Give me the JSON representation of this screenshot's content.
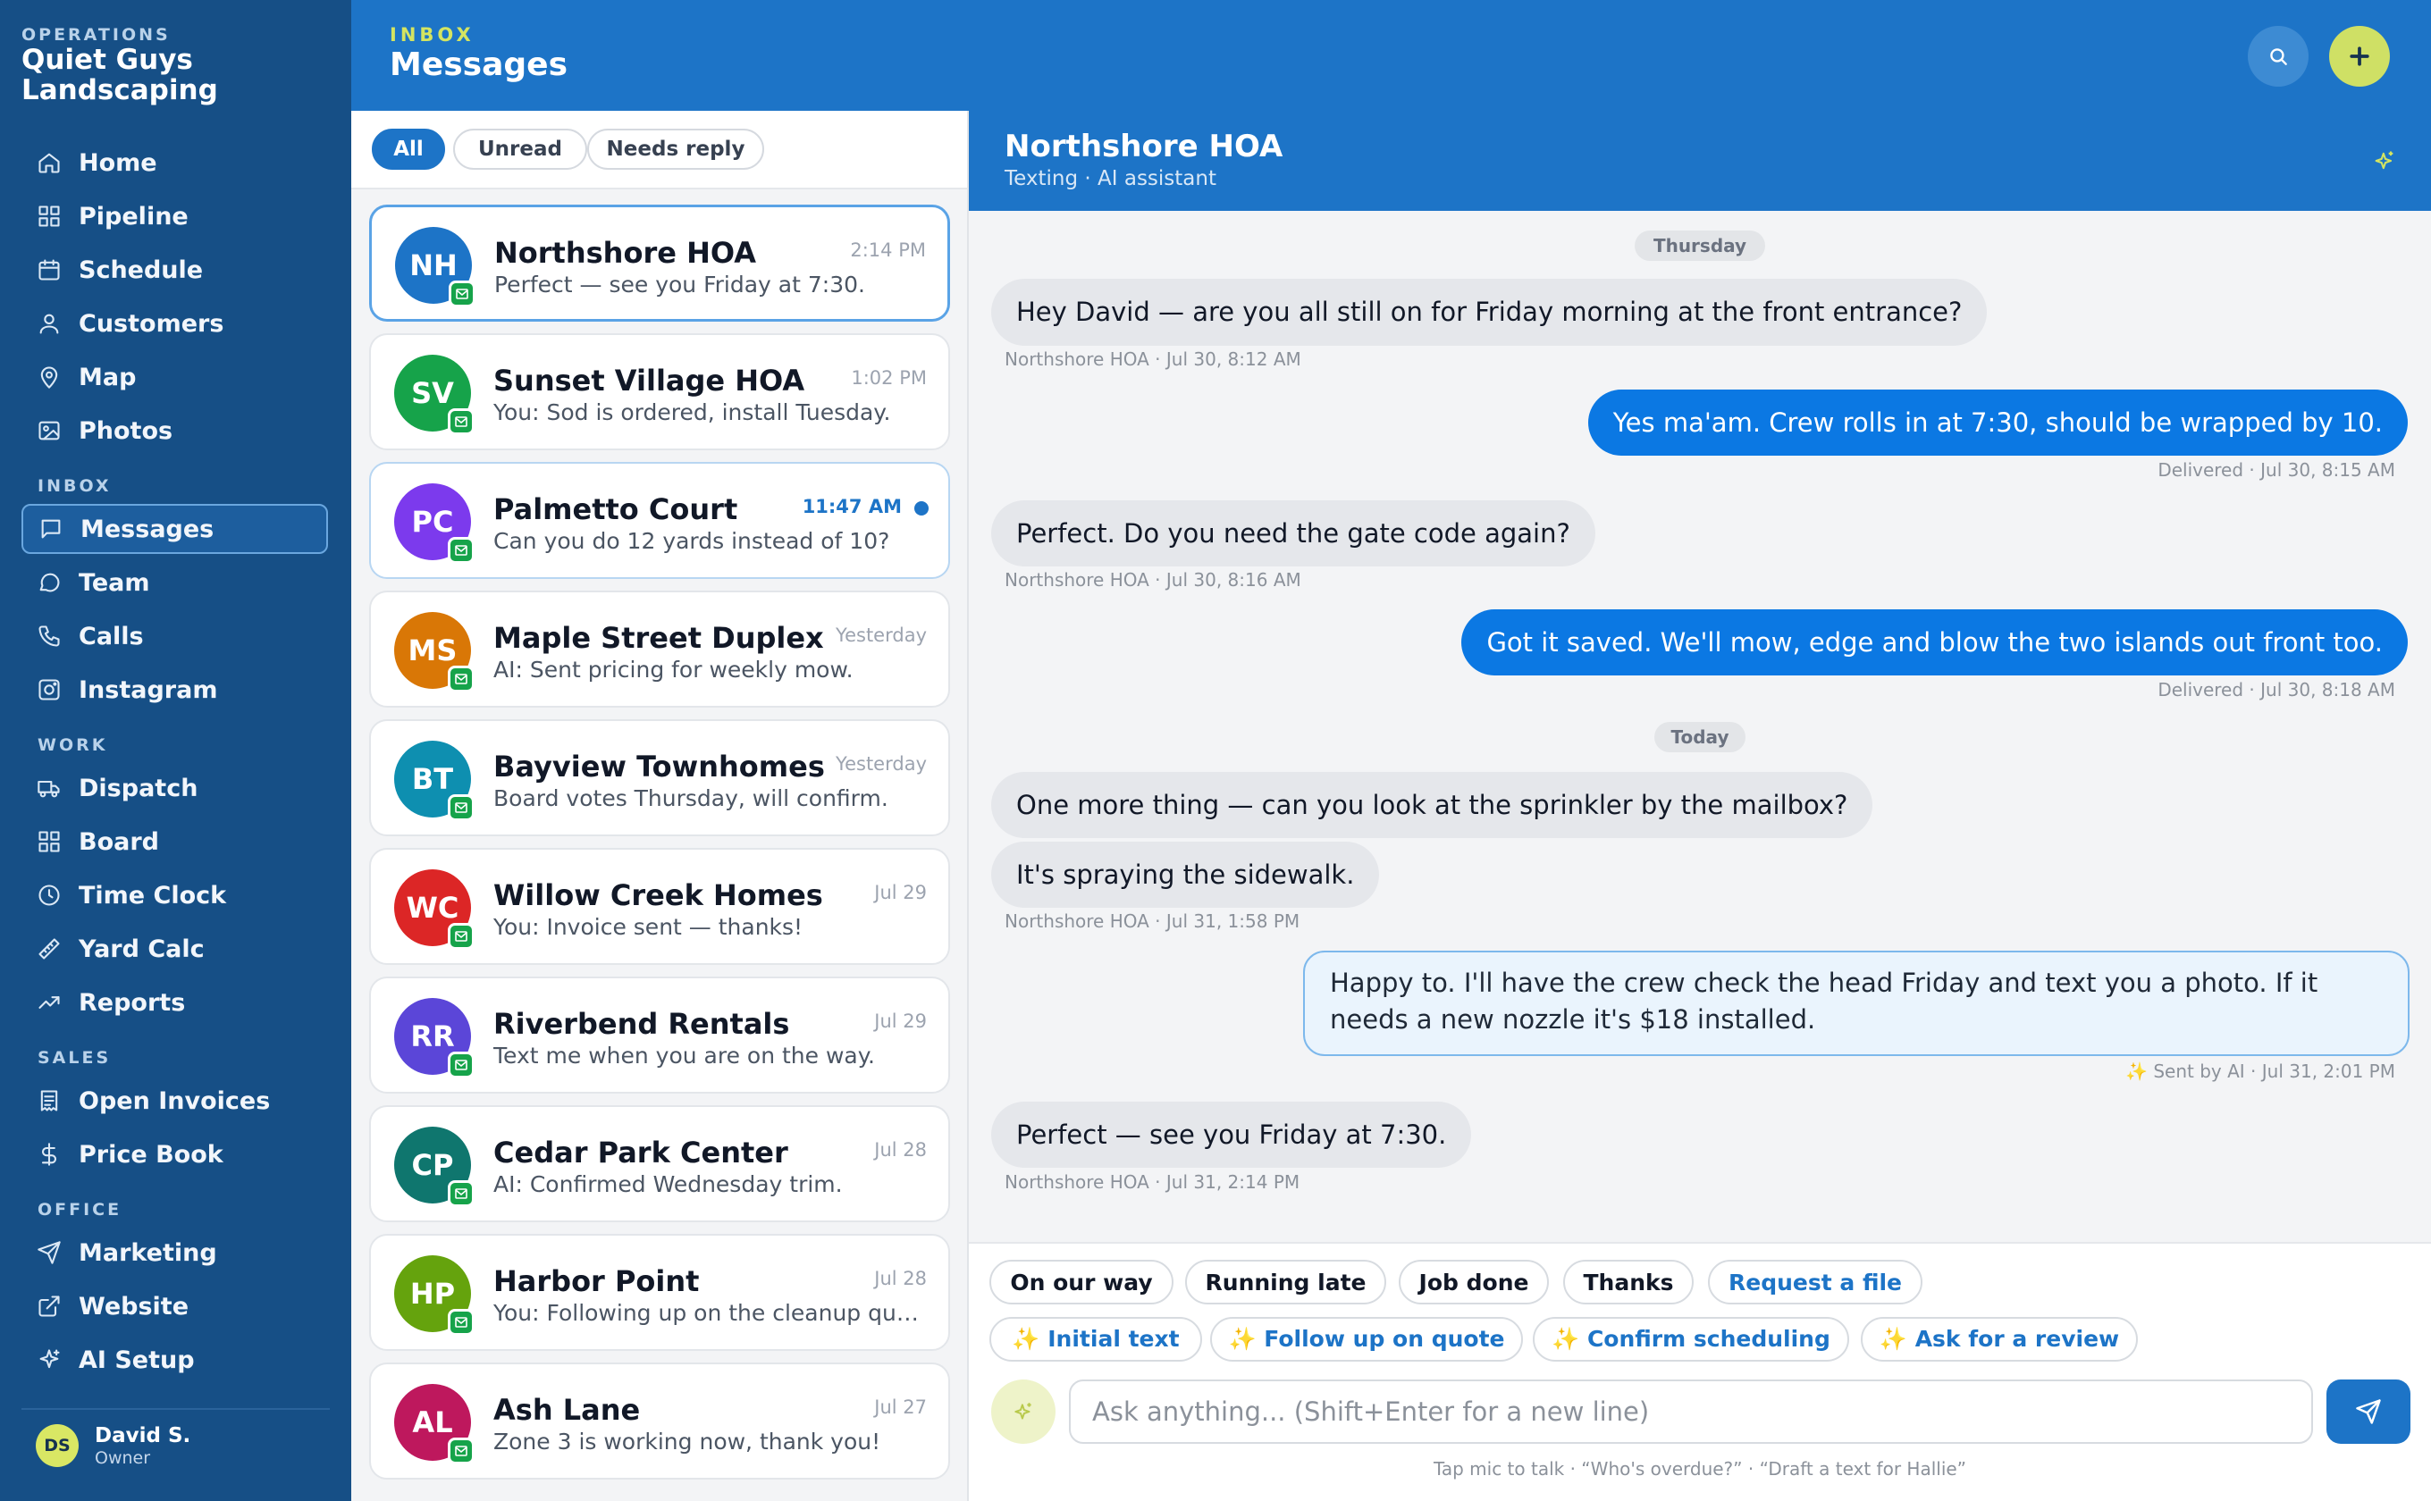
{
  "brand": {
    "kicker": "OPERATIONS",
    "name": "Quiet Guys Landscaping"
  },
  "nav": {
    "main": [
      {
        "label": "Home",
        "icon": "home-icon"
      },
      {
        "label": "Pipeline",
        "icon": "grid-icon"
      },
      {
        "label": "Schedule",
        "icon": "calendar-icon"
      },
      {
        "label": "Customers",
        "icon": "user-icon"
      },
      {
        "label": "Map",
        "icon": "map-pin-icon"
      },
      {
        "label": "Photos",
        "icon": "image-icon"
      }
    ],
    "inbox_header": "INBOX",
    "inbox": [
      {
        "label": "Messages",
        "icon": "message-square-icon",
        "active": true
      },
      {
        "label": "Team",
        "icon": "message-circle-icon"
      },
      {
        "label": "Calls",
        "icon": "phone-icon"
      },
      {
        "label": "Instagram",
        "icon": "instagram-icon"
      }
    ],
    "work_header": "WORK",
    "work": [
      {
        "label": "Dispatch",
        "icon": "truck-icon"
      },
      {
        "label": "Board",
        "icon": "board-icon"
      },
      {
        "label": "Time Clock",
        "icon": "clock-icon"
      },
      {
        "label": "Yard Calc",
        "icon": "ruler-icon"
      },
      {
        "label": "Reports",
        "icon": "trending-up-icon"
      }
    ],
    "sales_header": "SALES",
    "sales": [
      {
        "label": "Open Invoices",
        "icon": "receipt-icon"
      },
      {
        "label": "Price Book",
        "icon": "dollar-icon"
      }
    ],
    "office_header": "OFFICE",
    "office": [
      {
        "label": "Marketing",
        "icon": "send-icon"
      },
      {
        "label": "Website",
        "icon": "external-link-icon"
      },
      {
        "label": "AI Setup",
        "icon": "sparkle-icon"
      }
    ]
  },
  "user": {
    "initials": "DS",
    "name": "David S.",
    "role": "Owner"
  },
  "topbar": {
    "kicker": "INBOX",
    "title": "Messages"
  },
  "filters": [
    {
      "label": "All",
      "active": true
    },
    {
      "label": "Unread"
    },
    {
      "label": "Needs reply"
    }
  ],
  "conversations": [
    {
      "initials": "NH",
      "name": "Northshore HOA",
      "preview": "Perfect — see you Friday at 7:30.",
      "time": "2:14 PM",
      "color": "#1d74c7",
      "selected": true
    },
    {
      "initials": "SV",
      "name": "Sunset Village HOA",
      "preview": "You: Sod is ordered, install Tuesday.",
      "time": "1:02 PM",
      "color": "#16a34a"
    },
    {
      "initials": "PC",
      "name": "Palmetto Court",
      "preview": "Can you do 12 yards instead of 10?",
      "time": "11:47 AM",
      "color": "#7c3aed",
      "unread": true
    },
    {
      "initials": "MS",
      "name": "Maple Street Duplex",
      "preview": "AI: Sent pricing for weekly mow.",
      "time": "Yesterday",
      "color": "#d97706"
    },
    {
      "initials": "BT",
      "name": "Bayview Townhomes",
      "preview": "Board votes Thursday, will confirm.",
      "time": "Yesterday",
      "color": "#0e8fb0"
    },
    {
      "initials": "WC",
      "name": "Willow Creek Homes",
      "preview": "You: Invoice sent — thanks!",
      "time": "Jul 29",
      "color": "#dc2626"
    },
    {
      "initials": "RR",
      "name": "Riverbend Rentals",
      "preview": "Text me when you are on the way.",
      "time": "Jul 29",
      "color": "#5b46d8"
    },
    {
      "initials": "CP",
      "name": "Cedar Park Center",
      "preview": "AI: Confirmed Wednesday trim.",
      "time": "Jul 28",
      "color": "#0f766e"
    },
    {
      "initials": "HP",
      "name": "Harbor Point",
      "preview": "You: Following up on the cleanup quote from last week.",
      "time": "Jul 28",
      "color": "#65a30d"
    },
    {
      "initials": "AL",
      "name": "Ash Lane",
      "preview": "Zone 3 is working now, thank you!",
      "time": "Jul 27",
      "color": "#be185d"
    }
  ],
  "chat": {
    "name": "Northshore HOA",
    "subtitle": "Texting · AI assistant",
    "day1": "Thursday",
    "day2": "Today",
    "messages": [
      {
        "dir": "in",
        "text": "Hey David — are you all still on for Friday morning at the front entrance?",
        "meta": "Northshore HOA · Jul 30, 8:12 AM"
      },
      {
        "dir": "out",
        "text": "Yes ma'am. Crew rolls in at 7:30, should be wrapped by 10.",
        "meta": "Delivered · Jul 30, 8:15 AM"
      },
      {
        "dir": "in",
        "text": "Perfect. Do you need the gate code again?",
        "meta": "Northshore HOA · Jul 30, 8:16 AM"
      },
      {
        "dir": "out",
        "text": "Got it saved. We'll mow, edge and blow the two islands out front too.",
        "meta": "Delivered · Jul 30, 8:18 AM"
      },
      {
        "dir": "in",
        "text": "One more thing — can you look at the sprinkler by the mailbox?"
      },
      {
        "dir": "in",
        "text": "It's spraying the sidewalk.",
        "meta": "Northshore HOA · Jul 31, 1:58 PM"
      },
      {
        "dir": "ai",
        "text": "Happy to. I'll have the crew check the head Friday and text you a photo. If it needs a new nozzle it's $18 installed.",
        "meta": "✨ Sent by AI · Jul 31, 2:01 PM"
      },
      {
        "dir": "in",
        "text": "Perfect — see you Friday at 7:30.",
        "meta": "Northshore HOA · Jul 31, 2:14 PM"
      }
    ]
  },
  "quick_replies": [
    "On our way",
    "Running late",
    "Job done",
    "Thanks",
    "Request a file"
  ],
  "ai_actions": [
    "✨ Initial text",
    "✨ Follow up on quote",
    "✨ Confirm scheduling",
    "✨ Ask for a review"
  ],
  "composer": {
    "placeholder": "Ask anything... (Shift+Enter for a new line)",
    "hint": "Tap mic to talk · “Who's overdue?” · “Draft a text for Hallie”"
  },
  "colors": {
    "sidebar": "#164f86",
    "primary": "#1d74c7",
    "accent": "#d4e461",
    "sms_green": "#16a34a"
  }
}
